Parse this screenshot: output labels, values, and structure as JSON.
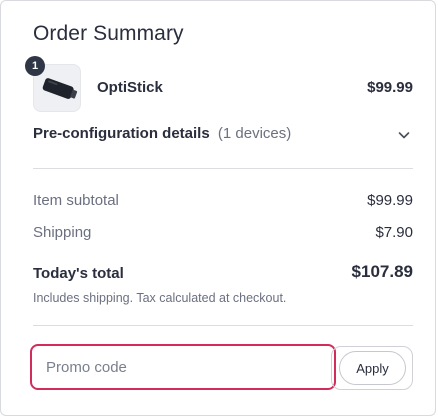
{
  "order_summary": {
    "title": "Order Summary",
    "product": {
      "quantity": "1",
      "name": "OptiStick",
      "price": "$99.99",
      "image_icon": "usb-stick-icon"
    },
    "preconfiguration": {
      "label": "Pre-configuration details",
      "detail": "(1 devices)",
      "toggle_icon": "chevron-down-icon"
    },
    "subtotal": {
      "label": "Item subtotal",
      "value": "$99.99"
    },
    "shipping": {
      "label": "Shipping",
      "value": "$7.90"
    },
    "total": {
      "label": "Today's total",
      "value": "$107.89"
    },
    "note": "Includes shipping. Tax calculated at checkout.",
    "promo": {
      "placeholder": "Promo code",
      "value": "",
      "apply_label": "Apply"
    }
  },
  "colors": {
    "text_primary": "#2a2e3d",
    "text_secondary": "#6b7080",
    "focus_border": "#d22c5a",
    "badge": "#2f3645"
  }
}
